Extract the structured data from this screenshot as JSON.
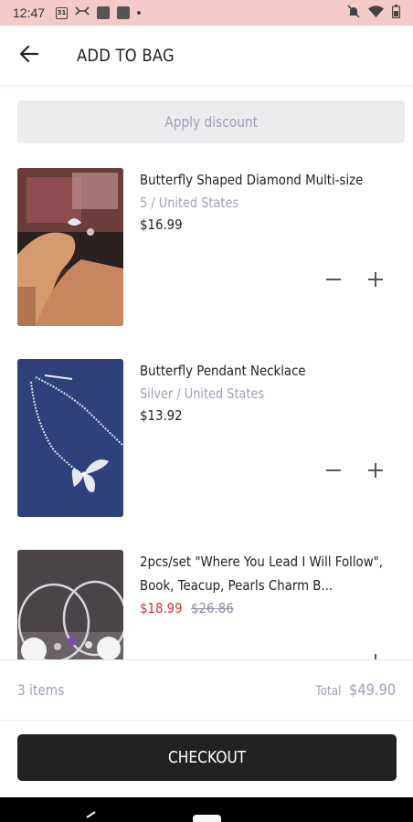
{
  "status_bar": {
    "time": "12:47",
    "calendar_day": "31",
    "icons": [
      "calendar-icon",
      "cast-icon",
      "square-icon",
      "square-icon",
      "dot-icon",
      "mute-icon",
      "wifi-icon",
      "battery-icon"
    ]
  },
  "header": {
    "back_icon": "arrow-left-icon",
    "title": "ADD TO BAG"
  },
  "discount": {
    "label": "Apply discount"
  },
  "cart": {
    "items": [
      {
        "name": "Butterfly Shaped Diamond Multi-size",
        "variant": "5 / United States",
        "price": "$16.99",
        "image": "photo-ring-hand"
      },
      {
        "name": "Butterfly Pendant Necklace",
        "variant": "Silver / United States",
        "price": "$13.92",
        "image": "photo-butterfly-necklace"
      },
      {
        "name": "2pcs/set \"Where You Lead I Will Follow\", Book, Teacup, Pearls Charm B...",
        "sale_price": "$18.99",
        "original_price": "$26.86",
        "image": "photo-charm-bracelets"
      }
    ],
    "minus_icon": "minus-icon",
    "plus_icon": "plus-icon"
  },
  "summary": {
    "items_count": "3 items",
    "total_label": "Total",
    "total_value": "$49.90"
  },
  "checkout": {
    "label": "CHECKOUT"
  },
  "colors": {
    "status_bar": "#f4c9c9",
    "muted_text": "#9da1b8",
    "sale_red": "#d0303a",
    "checkout_bg": "#222222"
  }
}
